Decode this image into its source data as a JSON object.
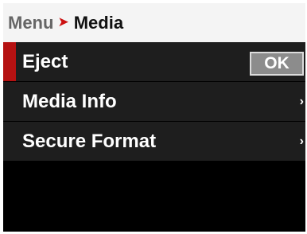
{
  "header": {
    "parent": "Menu",
    "separator_icon": "chevron-right-icon",
    "current": "Media"
  },
  "menu": {
    "items": [
      {
        "label": "Eject",
        "selected": true,
        "action_label": "OK"
      },
      {
        "label": "Media Info",
        "icon": "chevron-right-icon",
        "chevron": "›"
      },
      {
        "label": "Secure Format",
        "icon": "chevron-right-icon",
        "chevron": "›"
      }
    ]
  },
  "colors": {
    "accent": "#b51212",
    "row_background": "#1e1e1e",
    "screen_background": "#000000",
    "header_background": "#f4f4f4"
  }
}
